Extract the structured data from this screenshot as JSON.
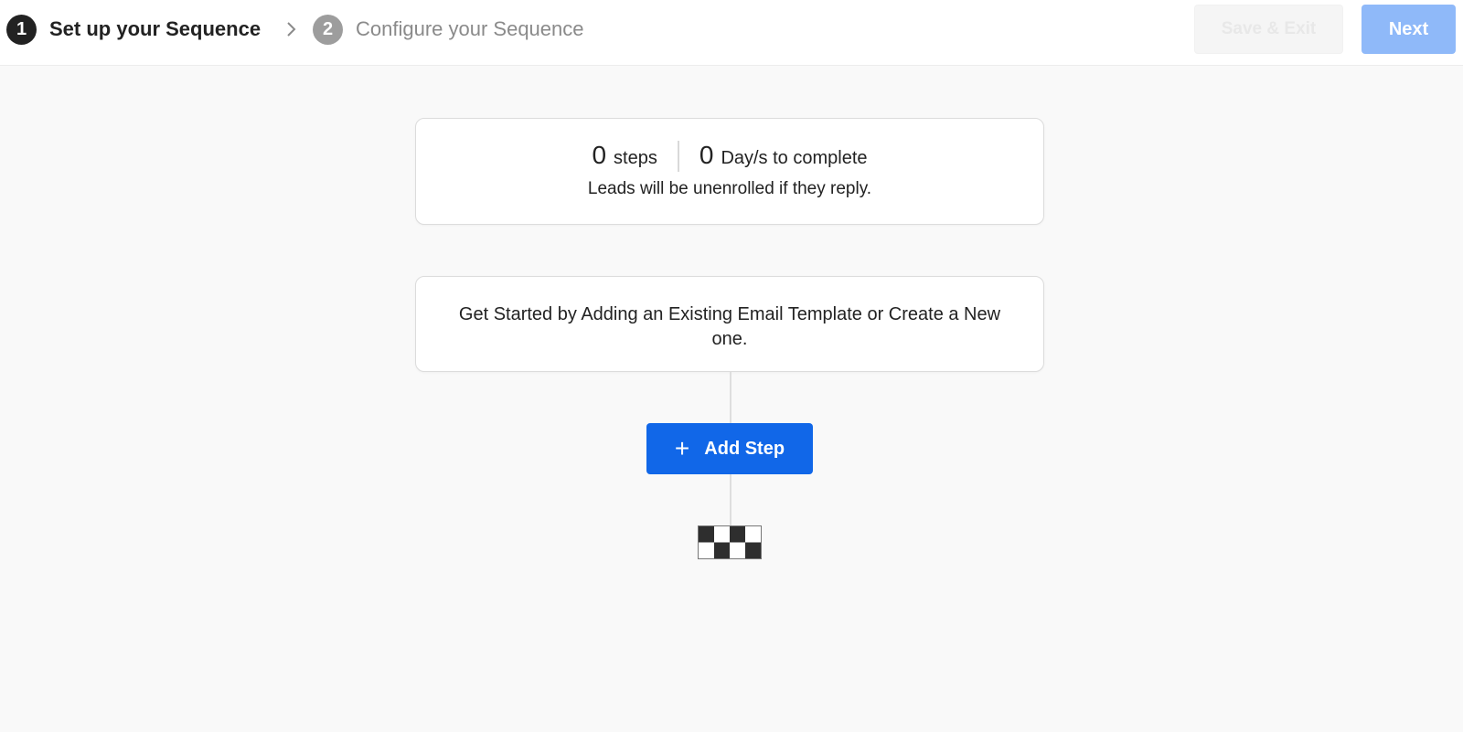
{
  "header": {
    "steps": [
      {
        "number": "1",
        "label": "Set up your Sequence",
        "state": "active"
      },
      {
        "number": "2",
        "label": "Configure your Sequence",
        "state": "inactive"
      }
    ],
    "separator_icon": "chevron-right-icon",
    "save_exit_label": "Save & Exit",
    "next_label": "Next"
  },
  "summary": {
    "steps_count": "0",
    "steps_unit": "steps",
    "days_count": "0",
    "days_unit": "Day/s to complete",
    "note": "Leads will be unenrolled if they reply."
  },
  "empty_state": {
    "text": "Get Started by Adding an Existing Email Template or Create a New one."
  },
  "actions": {
    "add_step_label": "Add Step",
    "add_step_icon": "plus-icon"
  },
  "finish_icon": "checkered-flag-icon",
  "colors": {
    "primary": "#1167e8",
    "next_disabled": "#8fb9f9",
    "active_step": "#222222",
    "inactive_step": "#9d9d9d"
  }
}
